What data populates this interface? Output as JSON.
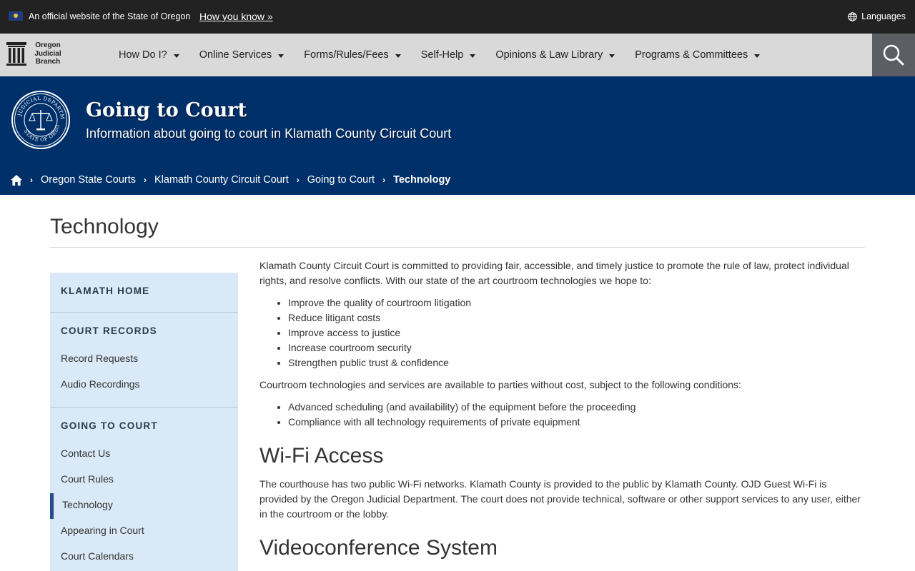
{
  "banner": {
    "official_text": "An official website of the State of Oregon",
    "how_you_know": "How you know »",
    "languages": "Languages"
  },
  "logo": {
    "line1": "Oregon",
    "line2": "Judicial",
    "line3": "Branch"
  },
  "nav": {
    "items": [
      {
        "label": "How Do I?"
      },
      {
        "label": "Online Services"
      },
      {
        "label": "Forms/Rules/Fees"
      },
      {
        "label": "Self-Help"
      },
      {
        "label": "Opinions & Law Library"
      },
      {
        "label": "Programs & Committees"
      }
    ]
  },
  "hero": {
    "title": "Going to Court",
    "subtitle": "Information about going to court in Klamath County Circuit Court",
    "seal_text": "JUDICIAL DEPARTMENT · STATE OF OREGON"
  },
  "breadcrumb": {
    "items": [
      {
        "label": "Oregon State Courts"
      },
      {
        "label": "Klamath County Circuit Court"
      },
      {
        "label": "Going to Court"
      }
    ],
    "current": "Technology"
  },
  "page": {
    "title": "Technology"
  },
  "sidebar": {
    "home": "KLAMATH HOME",
    "records_heading": "COURT RECORDS",
    "records_links": [
      {
        "label": "Record Requests"
      },
      {
        "label": "Audio Recordings"
      }
    ],
    "going_heading": "GOING TO COURT",
    "going_links": [
      {
        "label": "Contact Us"
      },
      {
        "label": "Court Rules"
      },
      {
        "label": "Technology"
      },
      {
        "label": "Appearing in Court"
      },
      {
        "label": "Court Calendars"
      }
    ]
  },
  "content": {
    "intro": "Klamath County Circuit Court is committed to providing fair, accessible, and timely justice to promote the rule of law, protect individual rights, and resolve conflicts. With our state of the art courtroom technologies we hope to:",
    "goals": [
      "Improve the quality of courtroom litigation",
      "Reduce litigant costs",
      "Improve access to justice",
      "Increase courtroom security",
      "Strengthen public trust & confidence"
    ],
    "conditions_intro": "Courtroom technologies and services are available to parties without cost, subject to the following conditions:",
    "conditions": [
      "Advanced scheduling (and availability) of the equipment before the proceeding",
      "Compliance with all technology requirements of private equipment"
    ],
    "wifi_heading": "Wi-Fi Access",
    "wifi_text": "The courthouse has two public Wi-Fi networks. Klamath County is provided to the public by Klamath County. OJD Guest Wi-Fi is provided by the Oregon Judicial Department. The court does not provide technical, software or other support services to any user, either in the courtroom or the lobby.",
    "video_heading": "Videoconference System"
  }
}
